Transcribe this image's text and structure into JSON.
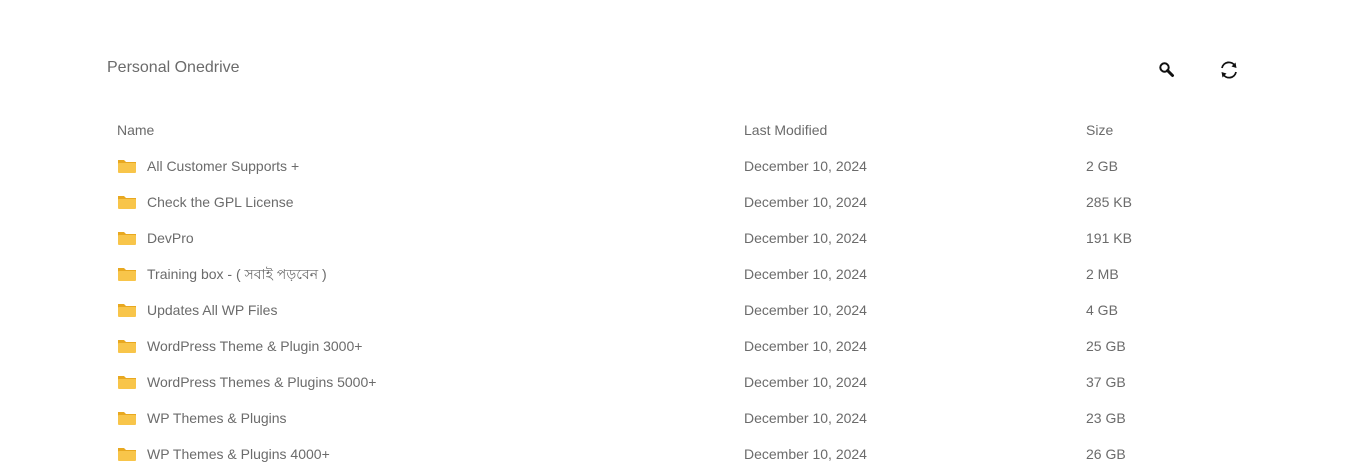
{
  "header": {
    "title": "Personal Onedrive",
    "search_icon": "search-icon",
    "refresh_icon": "refresh-icon"
  },
  "colors": {
    "text": "#6b6b6b",
    "folder": "#f8c54a",
    "folder_tab": "#e8a820",
    "background": "#ffffff"
  },
  "table": {
    "columns": {
      "name": "Name",
      "modified": "Last Modified",
      "size": "Size"
    },
    "rows": [
      {
        "name": "All Customer Supports +",
        "modified": "December 10, 2024",
        "size": "2 GB",
        "icon": "folder-icon"
      },
      {
        "name": "Check the GPL License",
        "modified": "December 10, 2024",
        "size": "285 KB",
        "icon": "folder-icon"
      },
      {
        "name": "DevPro",
        "modified": "December 10, 2024",
        "size": "191 KB",
        "icon": "folder-icon"
      },
      {
        "name": "Training box - ( সবাই পড়বেন )",
        "modified": "December 10, 2024",
        "size": "2 MB",
        "icon": "folder-icon"
      },
      {
        "name": "Updates All WP Files",
        "modified": "December 10, 2024",
        "size": "4 GB",
        "icon": "folder-icon"
      },
      {
        "name": "WordPress Theme & Plugin 3000+",
        "modified": "December 10, 2024",
        "size": "25 GB",
        "icon": "folder-icon"
      },
      {
        "name": "WordPress Themes & Plugins 5000+",
        "modified": "December 10, 2024",
        "size": "37 GB",
        "icon": "folder-icon"
      },
      {
        "name": "WP Themes & Plugins",
        "modified": "December 10, 2024",
        "size": "23 GB",
        "icon": "folder-icon"
      },
      {
        "name": "WP Themes & Plugins 4000+",
        "modified": "December 10, 2024",
        "size": "26 GB",
        "icon": "folder-icon"
      }
    ]
  }
}
